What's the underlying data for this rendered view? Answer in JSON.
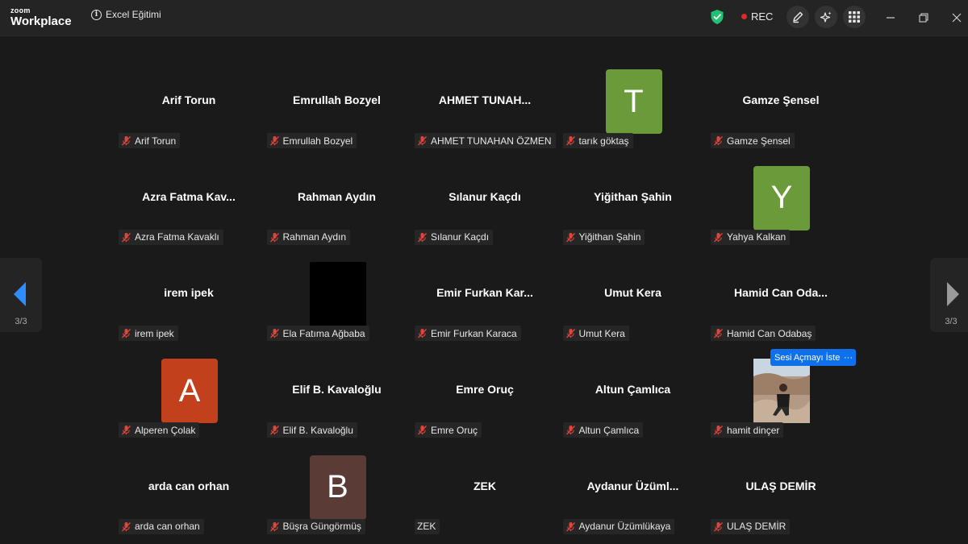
{
  "app": {
    "brand_small": "zoom",
    "brand_big": "Workplace"
  },
  "meeting": {
    "title": "Excel Eğitimi",
    "info_icon": "info-icon"
  },
  "toolbar": {
    "rec_label": "REC",
    "shield_icon": "shield-check-icon",
    "annotate_icon": "pen-icon",
    "ai_icon": "sparkle-icon",
    "apps_icon": "grid-icon"
  },
  "nav": {
    "left_page": "3/3",
    "right_page": "3/3"
  },
  "colors": {
    "avatar_green": "#6a9a39",
    "avatar_red": "#c2401c",
    "avatar_brown": "#5a3b36",
    "unmute_blue": "#0e71eb",
    "mic_muted": "#e0443a"
  },
  "request": {
    "unmute_label": "Sesi Açmayı İste",
    "more_label": "···"
  },
  "participants": [
    {
      "name": "Arif Torun",
      "display": "Arif Torun",
      "type": "name",
      "muted": true
    },
    {
      "name": "Emrullah Bozyel",
      "display": "Emrullah Bozyel",
      "type": "name",
      "muted": true
    },
    {
      "name": "AHMET TUNAHAN ÖZMEN",
      "display": "AHMET TUNAH...",
      "type": "name",
      "muted": true
    },
    {
      "name": "tarık göktaş",
      "display": "T",
      "type": "avatar",
      "color": "#6a9a39",
      "muted": true
    },
    {
      "name": "Gamze Şensel",
      "display": "Gamze Şensel",
      "type": "name",
      "muted": true
    },
    {
      "name": "Azra Fatma Kavaklı",
      "display": "Azra Fatma Kav...",
      "type": "name",
      "muted": true
    },
    {
      "name": "Rahman Aydın",
      "display": "Rahman Aydın",
      "type": "name",
      "muted": true
    },
    {
      "name": "Sılanur Kaçdı",
      "display": "Sılanur Kaçdı",
      "type": "name",
      "muted": true
    },
    {
      "name": "Yiğithan Şahin",
      "display": "Yiğithan Şahin",
      "type": "name",
      "muted": true
    },
    {
      "name": "Yahya Kalkan",
      "display": "Y",
      "type": "avatar",
      "color": "#6a9a39",
      "muted": true
    },
    {
      "name": "irem ipek",
      "display": "irem ipek",
      "type": "name",
      "muted": true
    },
    {
      "name": "Ela Fatıma Ağbaba",
      "display": "",
      "type": "avatar",
      "color": "#000000",
      "muted": true
    },
    {
      "name": "Emir Furkan Karaca",
      "display": "Emir Furkan Kar...",
      "type": "name",
      "muted": true
    },
    {
      "name": "Umut Kera",
      "display": "Umut Kera",
      "type": "name",
      "muted": true
    },
    {
      "name": "Hamid Can Odabaş",
      "display": "Hamid Can Oda...",
      "type": "name",
      "muted": true
    },
    {
      "name": "Alperen Çolak",
      "display": "A",
      "type": "avatar",
      "color": "#c2401c",
      "muted": true
    },
    {
      "name": "Elif B. Kavaloğlu",
      "display": "Elif B. Kavaloğlu",
      "type": "name",
      "muted": true
    },
    {
      "name": "Emre Oruç",
      "display": "Emre Oruç",
      "type": "name",
      "muted": true
    },
    {
      "name": "Altun Çamlıca",
      "display": "Altun Çamlıca",
      "type": "name",
      "muted": true
    },
    {
      "name": "hamit dinçer",
      "display": "",
      "type": "photo",
      "muted": true
    },
    {
      "name": "arda can orhan",
      "display": "arda can orhan",
      "type": "name",
      "muted": true
    },
    {
      "name": "Büşra Güngörmüş",
      "display": "B",
      "type": "avatar",
      "color": "#5a3b36",
      "muted": true
    },
    {
      "name": "ZEK",
      "display": "ZEK",
      "type": "name",
      "muted": false
    },
    {
      "name": "Aydanur Üzümlükaya",
      "display": "Aydanur Üzüml...",
      "type": "name",
      "muted": true
    },
    {
      "name": "ULAŞ DEMİR",
      "display": "ULAŞ DEMİR",
      "type": "name",
      "muted": true
    }
  ]
}
